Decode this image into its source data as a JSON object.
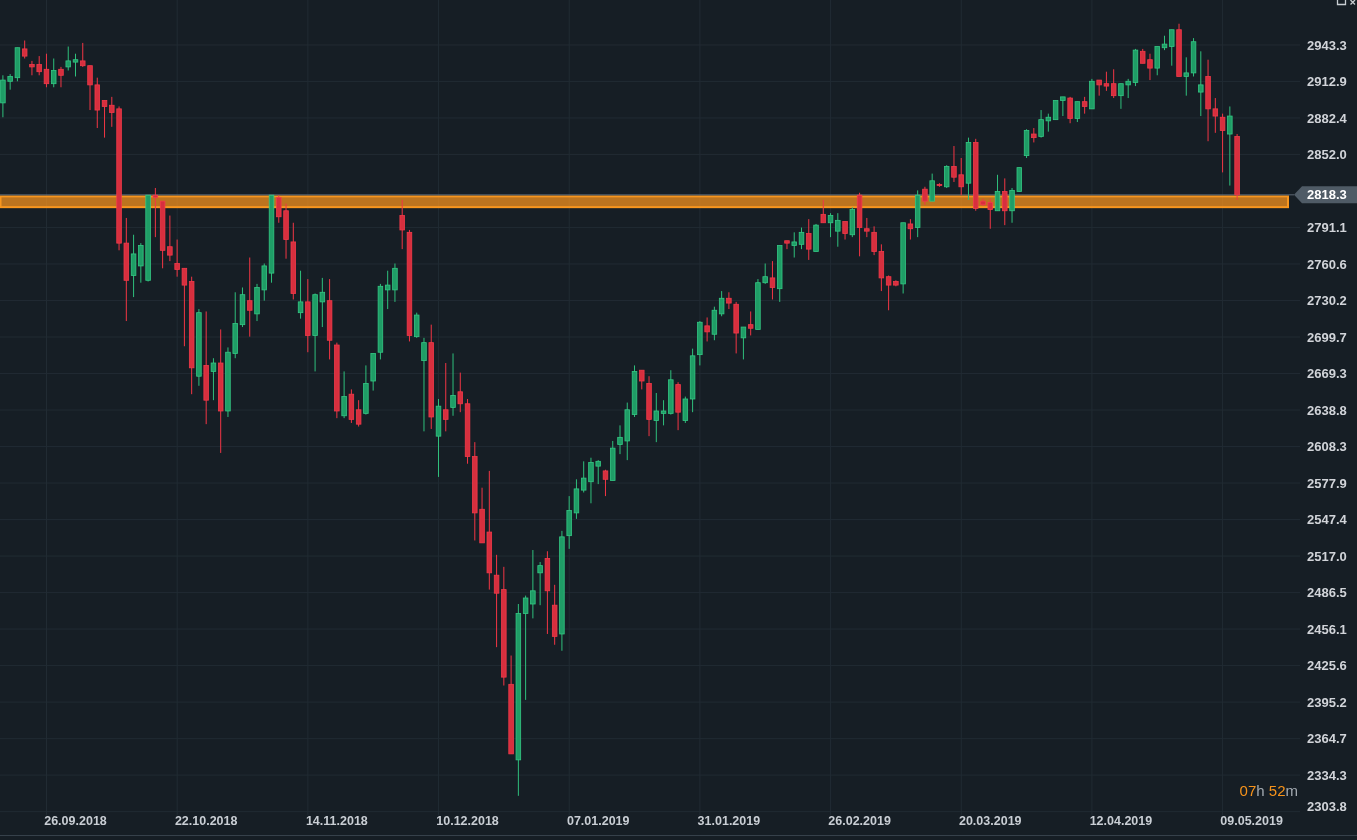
{
  "chart": {
    "chart_data": {
      "type": "candlestick",
      "ylim": [
        2303.5,
        2980.8
      ],
      "grid": true,
      "categories": [
        null,
        null,
        null,
        null,
        null,
        null,
        null,
        null,
        null,
        null,
        "26.09.2018",
        null,
        null,
        null,
        null,
        null,
        null,
        null,
        null,
        null,
        null,
        null,
        null,
        null,
        null,
        null,
        null,
        null,
        "22.10.2018",
        null,
        null,
        null,
        null,
        null,
        null,
        null,
        null,
        null,
        null,
        null,
        null,
        null,
        null,
        null,
        null,
        null,
        "14.11.2018",
        null,
        null,
        null,
        null,
        null,
        null,
        null,
        null,
        null,
        null,
        null,
        null,
        null,
        null,
        null,
        null,
        null,
        "10.12.2018",
        null,
        null,
        null,
        null,
        null,
        null,
        null,
        null,
        null,
        null,
        null,
        null,
        null,
        null,
        null,
        null,
        null,
        "07.01.2019",
        null,
        null,
        null,
        null,
        null,
        null,
        null,
        null,
        null,
        null,
        null,
        null,
        null,
        null,
        null,
        null,
        null,
        "31.01.2019",
        null,
        null,
        null,
        null,
        null,
        null,
        null,
        null,
        null,
        null,
        null,
        null,
        null,
        null,
        null,
        null,
        null,
        "26.02.2019",
        null,
        null,
        null,
        null,
        null,
        null,
        null,
        null,
        null,
        null,
        null,
        null,
        null,
        null,
        null,
        null,
        null,
        "20.03.2019",
        null,
        null,
        null,
        null,
        null,
        null,
        null,
        null,
        null,
        null,
        null,
        null,
        null,
        null,
        null,
        null,
        null,
        "12.04.2019",
        null,
        null,
        null,
        null,
        null,
        null,
        null,
        null,
        null,
        null,
        null,
        null,
        null,
        null,
        null,
        null,
        null,
        "09.05.2019"
      ],
      "yticks": [
        2943.3,
        2912.9,
        2882.4,
        {
          "value": 2852.0,
          "label": "2852.0"
        },
        2791.1,
        2760.6,
        2730.2,
        2699.7,
        2669.3,
        2638.8,
        2608.3,
        2577.9,
        2547.4,
        {
          "value": 2517.0,
          "label": "2517.0"
        },
        2486.5,
        2456.1,
        2425.6,
        2395.2,
        2364.7,
        2334.3,
        2303.8
      ],
      "ohlc": [
        [
          2895,
          2918,
          2883,
          2914
        ],
        [
          2913,
          2919,
          2906,
          2917
        ],
        [
          2916,
          2941,
          2913,
          2941
        ],
        [
          2940,
          2947,
          2932,
          2934
        ],
        [
          2927,
          2930,
          2918,
          2925
        ],
        [
          2927,
          2934,
          2918,
          2921
        ],
        [
          2923,
          2936,
          2908,
          2911
        ],
        [
          2911,
          2932,
          2908,
          2922
        ],
        [
          2923,
          2925,
          2908,
          2918
        ],
        [
          2925,
          2942,
          2922,
          2930
        ],
        [
          2929,
          2936,
          2917,
          2931
        ],
        [
          2930,
          2945,
          2925,
          2926
        ],
        [
          2926,
          2926,
          2889,
          2910
        ],
        [
          2910,
          2916,
          2874,
          2889
        ],
        [
          2897,
          2897,
          2866,
          2892
        ],
        [
          2893,
          2900,
          2875,
          2887
        ],
        [
          2890,
          2892,
          2772,
          2778
        ],
        [
          2778,
          2799,
          2713,
          2747
        ],
        [
          2751,
          2785,
          2733,
          2769
        ],
        [
          2759,
          2778,
          2745,
          2776
        ],
        [
          2747,
          2818,
          2746,
          2818
        ],
        [
          2818,
          2824,
          2783,
          2816
        ],
        [
          2813,
          2813,
          2757,
          2772
        ],
        [
          2775,
          2801,
          2763,
          2768
        ],
        [
          2761,
          2781,
          2750,
          2756
        ],
        [
          2757,
          2757,
          2692,
          2743
        ],
        [
          2746,
          2750,
          2652,
          2674
        ],
        [
          2667,
          2723,
          2659,
          2720
        ],
        [
          2676,
          2721,
          2627,
          2647
        ],
        [
          2671,
          2682,
          2647,
          2678
        ],
        [
          2678,
          2706,
          2603,
          2638
        ],
        [
          2638,
          2691,
          2633,
          2687
        ],
        [
          2686,
          2737,
          2682,
          2711
        ],
        [
          2710,
          2741,
          2708,
          2735
        ],
        [
          2730,
          2766,
          2700,
          2722
        ],
        [
          2719,
          2744,
          2713,
          2741
        ],
        [
          2739,
          2761,
          2730,
          2759
        ],
        [
          2753,
          2818,
          2745,
          2818
        ],
        [
          2816,
          2818,
          2795,
          2800
        ],
        [
          2805,
          2811,
          2765,
          2781
        ],
        [
          2779,
          2795,
          2731,
          2736
        ],
        [
          2720,
          2755,
          2715,
          2729
        ],
        [
          2729,
          2748,
          2687,
          2701
        ],
        [
          2701,
          2736,
          2671,
          2735
        ],
        [
          2729,
          2749,
          2708,
          2737
        ],
        [
          2730,
          2748,
          2681,
          2697
        ],
        [
          2693,
          2695,
          2632,
          2638
        ],
        [
          2634,
          2671,
          2632,
          2650
        ],
        [
          2652,
          2656,
          2628,
          2631
        ],
        [
          2639,
          2647,
          2625,
          2627
        ],
        [
          2636,
          2676,
          2635,
          2661
        ],
        [
          2663,
          2686,
          2655,
          2686
        ],
        [
          2687,
          2744,
          2681,
          2742
        ],
        [
          2739,
          2755,
          2723,
          2743
        ],
        [
          2739,
          2761,
          2729,
          2757
        ],
        [
          2801,
          2814,
          2773,
          2789
        ],
        [
          2787,
          2789,
          2696,
          2701
        ],
        [
          2700,
          2720,
          2699,
          2718
        ],
        [
          2680,
          2699,
          2621,
          2695
        ],
        [
          2695,
          2710,
          2623,
          2633
        ],
        [
          2617,
          2648,
          2583,
          2642
        ],
        [
          2639,
          2678,
          2621,
          2631
        ],
        [
          2641,
          2686,
          2634,
          2651
        ],
        [
          2654,
          2670,
          2637,
          2644
        ],
        [
          2644,
          2648,
          2594,
          2600
        ],
        [
          2600,
          2612,
          2530,
          2553
        ],
        [
          2556,
          2574,
          2528,
          2528
        ],
        [
          2537,
          2588,
          2489,
          2503
        ],
        [
          2501,
          2518,
          2441,
          2486
        ],
        [
          2489,
          2508,
          2409,
          2416
        ],
        [
          2410,
          2434,
          2352,
          2352
        ],
        [
          2347,
          2477,
          2317,
          2469
        ],
        [
          2469,
          2484,
          2397,
          2482
        ],
        [
          2477,
          2522,
          2465,
          2488
        ],
        [
          2503,
          2512,
          2476,
          2509
        ],
        [
          2515,
          2521,
          2452,
          2488
        ],
        [
          2476,
          2493,
          2443,
          2450
        ],
        [
          2452,
          2538,
          2438,
          2533
        ],
        [
          2534,
          2567,
          2523,
          2555
        ],
        [
          2553,
          2581,
          2548,
          2573
        ],
        [
          2572,
          2596,
          2570,
          2582
        ],
        [
          2579,
          2599,
          2561,
          2595
        ],
        [
          2592,
          2597,
          2577,
          2596
        ],
        [
          2588,
          2589,
          2567,
          2581
        ],
        [
          2580,
          2613,
          2580,
          2607
        ],
        [
          2610,
          2626,
          2602,
          2616
        ],
        [
          2613,
          2645,
          2597,
          2639
        ],
        [
          2635,
          2676,
          2633,
          2671
        ],
        [
          2672,
          2672,
          2656,
          2663
        ],
        [
          2661,
          2667,
          2617,
          2631
        ],
        [
          2630,
          2653,
          2612,
          2638
        ],
        [
          2636,
          2647,
          2626,
          2638
        ],
        [
          2636,
          2672,
          2635,
          2664
        ],
        [
          2660,
          2662,
          2622,
          2637
        ],
        [
          2630,
          2650,
          2628,
          2648
        ],
        [
          2648,
          2690,
          2637,
          2684
        ],
        [
          2685,
          2713,
          2676,
          2712
        ],
        [
          2709,
          2716,
          2696,
          2704
        ],
        [
          2702,
          2725,
          2697,
          2722
        ],
        [
          2719,
          2738,
          2717,
          2732
        ],
        [
          2732,
          2737,
          2723,
          2728
        ],
        [
          2727,
          2729,
          2686,
          2703
        ],
        [
          2699,
          2708,
          2681,
          2708
        ],
        [
          2710,
          2721,
          2701,
          2707
        ],
        [
          2706,
          2748,
          2706,
          2745
        ],
        [
          2745,
          2761,
          2744,
          2750
        ],
        [
          2749,
          2763,
          2731,
          2741
        ],
        [
          2740,
          2776,
          2729,
          2776
        ],
        [
          2780,
          2780,
          2773,
          2778
        ],
        [
          2776,
          2787,
          2766,
          2779
        ],
        [
          2777,
          2791,
          2773,
          2787
        ],
        [
          2786,
          2798,
          2764,
          2773
        ],
        [
          2771,
          2794,
          2771,
          2793
        ],
        [
          2802,
          2814,
          2795,
          2795
        ],
        [
          2795,
          2803,
          2783,
          2801
        ],
        [
          2788,
          2803,
          2775,
          2797
        ],
        [
          2796,
          2796,
          2781,
          2786
        ],
        [
          2785,
          2808,
          2783,
          2806
        ],
        [
          2818,
          2820,
          2767,
          2791
        ],
        [
          2790,
          2799,
          2783,
          2788
        ],
        [
          2787,
          2792,
          2768,
          2771
        ],
        [
          2771,
          2777,
          2738,
          2749
        ],
        [
          2750,
          2751,
          2722,
          2743
        ],
        [
          2746,
          2747,
          2742,
          2743
        ],
        [
          2744,
          2795,
          2736,
          2795
        ],
        [
          2794,
          2798,
          2781,
          2790
        ],
        [
          2791,
          2822,
          2783,
          2818
        ],
        [
          2823,
          2825,
          2810,
          2813
        ],
        [
          2813,
          2836,
          2813,
          2830
        ],
        [
          2827,
          2828,
          2825,
          2826
        ],
        [
          2825,
          2843,
          2824,
          2842
        ],
        [
          2842,
          2859,
          2829,
          2833
        ],
        [
          2835,
          2849,
          2818,
          2825
        ],
        [
          2828,
          2866,
          2814,
          2862
        ],
        [
          2862,
          2865,
          2805,
          2807
        ],
        [
          2813,
          2815,
          2809,
          2810
        ],
        [
          2812,
          2815,
          2790,
          2806
        ],
        [
          2805,
          2835,
          2805,
          2821
        ],
        [
          2821,
          2832,
          2793,
          2805
        ],
        [
          2805,
          2824,
          2795,
          2822
        ],
        [
          2821,
          2841,
          2821,
          2841
        ],
        [
          2851,
          2873,
          2849,
          2872
        ],
        [
          2869,
          2874,
          2862,
          2866
        ],
        [
          2867,
          2889,
          2866,
          2881
        ],
        [
          2880,
          2886,
          2871,
          2883
        ],
        [
          2881,
          2897,
          2881,
          2897
        ],
        [
          2897,
          2900,
          2884,
          2900
        ],
        [
          2899,
          2900,
          2878,
          2882
        ],
        [
          2882,
          2896,
          2879,
          2896
        ],
        [
          2896,
          2900,
          2886,
          2892
        ],
        [
          2890,
          2915,
          2890,
          2913
        ],
        [
          2914,
          2914,
          2901,
          2910
        ],
        [
          2911,
          2921,
          2905,
          2909
        ],
        [
          2911,
          2923,
          2899,
          2901
        ],
        [
          2901,
          2911,
          2890,
          2911
        ],
        [
          2910,
          2915,
          2899,
          2913
        ],
        [
          2912,
          2940,
          2909,
          2939
        ],
        [
          2938,
          2940,
          2928,
          2928
        ],
        [
          2931,
          2936,
          2914,
          2924
        ],
        [
          2924,
          2942,
          2918,
          2942
        ],
        [
          2941,
          2951,
          2939,
          2944
        ],
        [
          2942,
          2956,
          2926,
          2956
        ],
        [
          2956,
          2961,
          2917,
          2917
        ],
        [
          2917,
          2933,
          2901,
          2920
        ],
        [
          2920,
          2949,
          2917,
          2946
        ],
        [
          2904,
          2938,
          2884,
          2910
        ],
        [
          2917,
          2931,
          2863,
          2890
        ],
        [
          2890,
          2899,
          2870,
          2884
        ],
        [
          2883,
          2886,
          2837,
          2872
        ],
        [
          2869,
          2892,
          2826,
          2884
        ],
        [
          2867,
          2869,
          2814,
          2818.3
        ],
        null,
        null
      ],
      "bands": [
        {
          "axis": "y",
          "from": 2817,
          "to": 2808
        }
      ],
      "ref_lines": [
        {
          "axis": "y",
          "value": 2818.3,
          "label": "2818.3"
        }
      ]
    },
    "countdown": [
      {
        "value": "07",
        "unit": "h"
      },
      {
        "value": "52",
        "unit": "m"
      }
    ]
  }
}
